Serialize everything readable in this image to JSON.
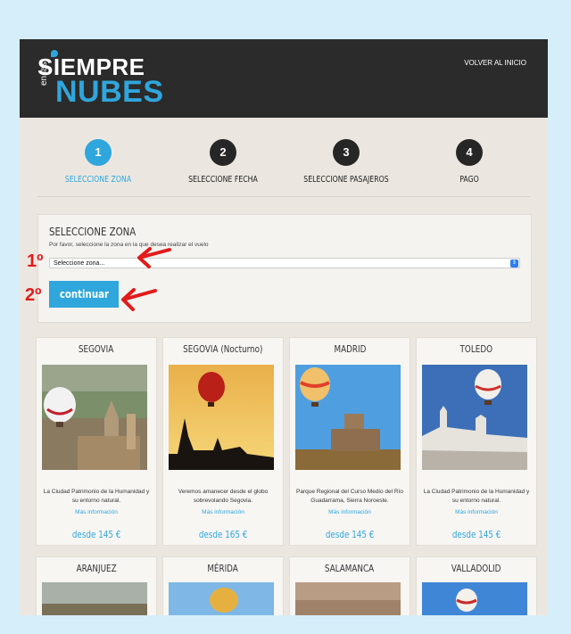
{
  "header": {
    "logo_top": "SIEMPRE",
    "logo_small": "en las",
    "logo_bottom": "NUBES",
    "back_link": "VOLVER AL INICIO"
  },
  "steps": [
    {
      "number": "1",
      "label": "SELECCIONE ZONA",
      "active": true
    },
    {
      "number": "2",
      "label": "SELECCIONE FECHA",
      "active": false
    },
    {
      "number": "3",
      "label": "SELECCIONE PASAJEROS",
      "active": false
    },
    {
      "number": "4",
      "label": "PAGO",
      "active": false
    }
  ],
  "zone": {
    "title": "SELECCIONE ZONA",
    "description": "Por favor, seleccione la zona en la que desea realizar el vuelo",
    "select_value": "Seleccione zona...",
    "continue_label": "continuar"
  },
  "annotations": {
    "first": "1º",
    "second": "2º"
  },
  "cards": [
    {
      "title": "SEGOVIA",
      "desc": "La Ciudad Patrimonio de la Humanidad y su entorno natural.",
      "more": "Más información",
      "price": "desde 145 €"
    },
    {
      "title": "SEGOVIA (Nocturno)",
      "desc": "Veremos amanecer desde el globo sobrevolando Segovia.",
      "more": "Más información",
      "price": "desde 165 €"
    },
    {
      "title": "MADRID",
      "desc": "Parque Regional del Curso Medio del Río Guadarrama, Sierra Noroeste.",
      "more": "Más información",
      "price": "desde 145 €"
    },
    {
      "title": "TOLEDO",
      "desc": "La Ciudad Patrimonio de la Humanidad y su entorno natural.",
      "more": "Más información",
      "price": "desde 145 €"
    }
  ],
  "cards_row2": [
    {
      "title": "ARANJUEZ"
    },
    {
      "title": "MÉRIDA"
    },
    {
      "title": "SALAMANCA"
    },
    {
      "title": "VALLADOLID"
    }
  ],
  "colors": {
    "accent": "#2fa6dc",
    "header_bg": "#2b2b2b",
    "annotation": "#e21b1b",
    "outer_bg": "#d6eef9"
  }
}
